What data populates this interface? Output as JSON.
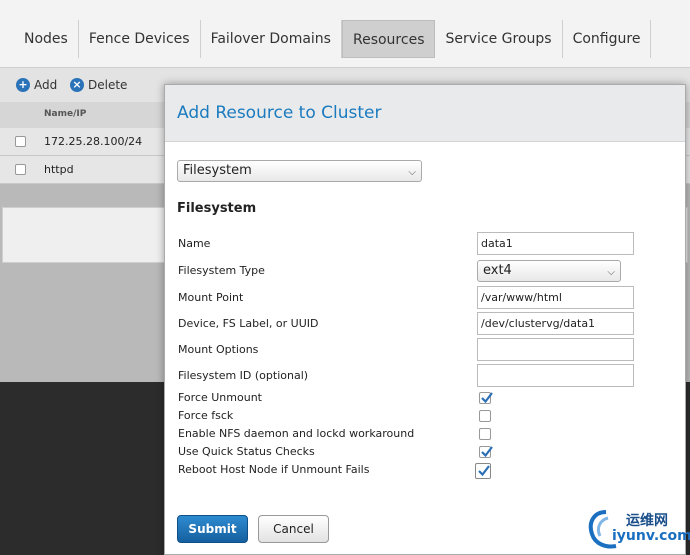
{
  "nav": {
    "tabs": [
      {
        "label": "Nodes"
      },
      {
        "label": "Fence Devices"
      },
      {
        "label": "Failover Domains"
      },
      {
        "label": "Resources",
        "active": true
      },
      {
        "label": "Service Groups"
      },
      {
        "label": "Configure"
      }
    ]
  },
  "toolbar": {
    "add_label": "Add",
    "delete_label": "Delete"
  },
  "list": {
    "column_header": "Name/IP",
    "rows": [
      {
        "name": "172.25.28.100/24"
      },
      {
        "name": "httpd"
      }
    ]
  },
  "modal": {
    "title": "Add Resource to Cluster",
    "resource_type": "Filesystem",
    "section_title": "Filesystem",
    "fields": {
      "name": {
        "label": "Name",
        "value": "data1"
      },
      "fs_type": {
        "label": "Filesystem Type",
        "value": "ext4"
      },
      "mount_point": {
        "label": "Mount Point",
        "value": "/var/www/html"
      },
      "device": {
        "label": "Device, FS Label, or UUID",
        "value": "/dev/clustervg/data1"
      },
      "mount_options": {
        "label": "Mount Options",
        "value": ""
      },
      "fs_id": {
        "label": "Filesystem ID (optional)",
        "value": ""
      }
    },
    "checkboxes": {
      "force_unmount": {
        "label": "Force Unmount",
        "checked": true
      },
      "force_fsck": {
        "label": "Force fsck",
        "checked": false
      },
      "nfs_workaround": {
        "label": "Enable NFS daemon and lockd workaround",
        "checked": false
      },
      "quick_status": {
        "label": "Use Quick Status Checks",
        "checked": true
      },
      "reboot_host": {
        "label": "Reboot Host Node if Unmount Fails",
        "checked": true
      }
    },
    "submit_label": "Submit",
    "cancel_label": "Cancel"
  },
  "watermark": {
    "top_text": "运维网",
    "bottom_text": "iyunv.com"
  },
  "colors": {
    "accent": "#1b7bbf",
    "submit": "#1f74b8",
    "check": "#2b6fb6"
  }
}
